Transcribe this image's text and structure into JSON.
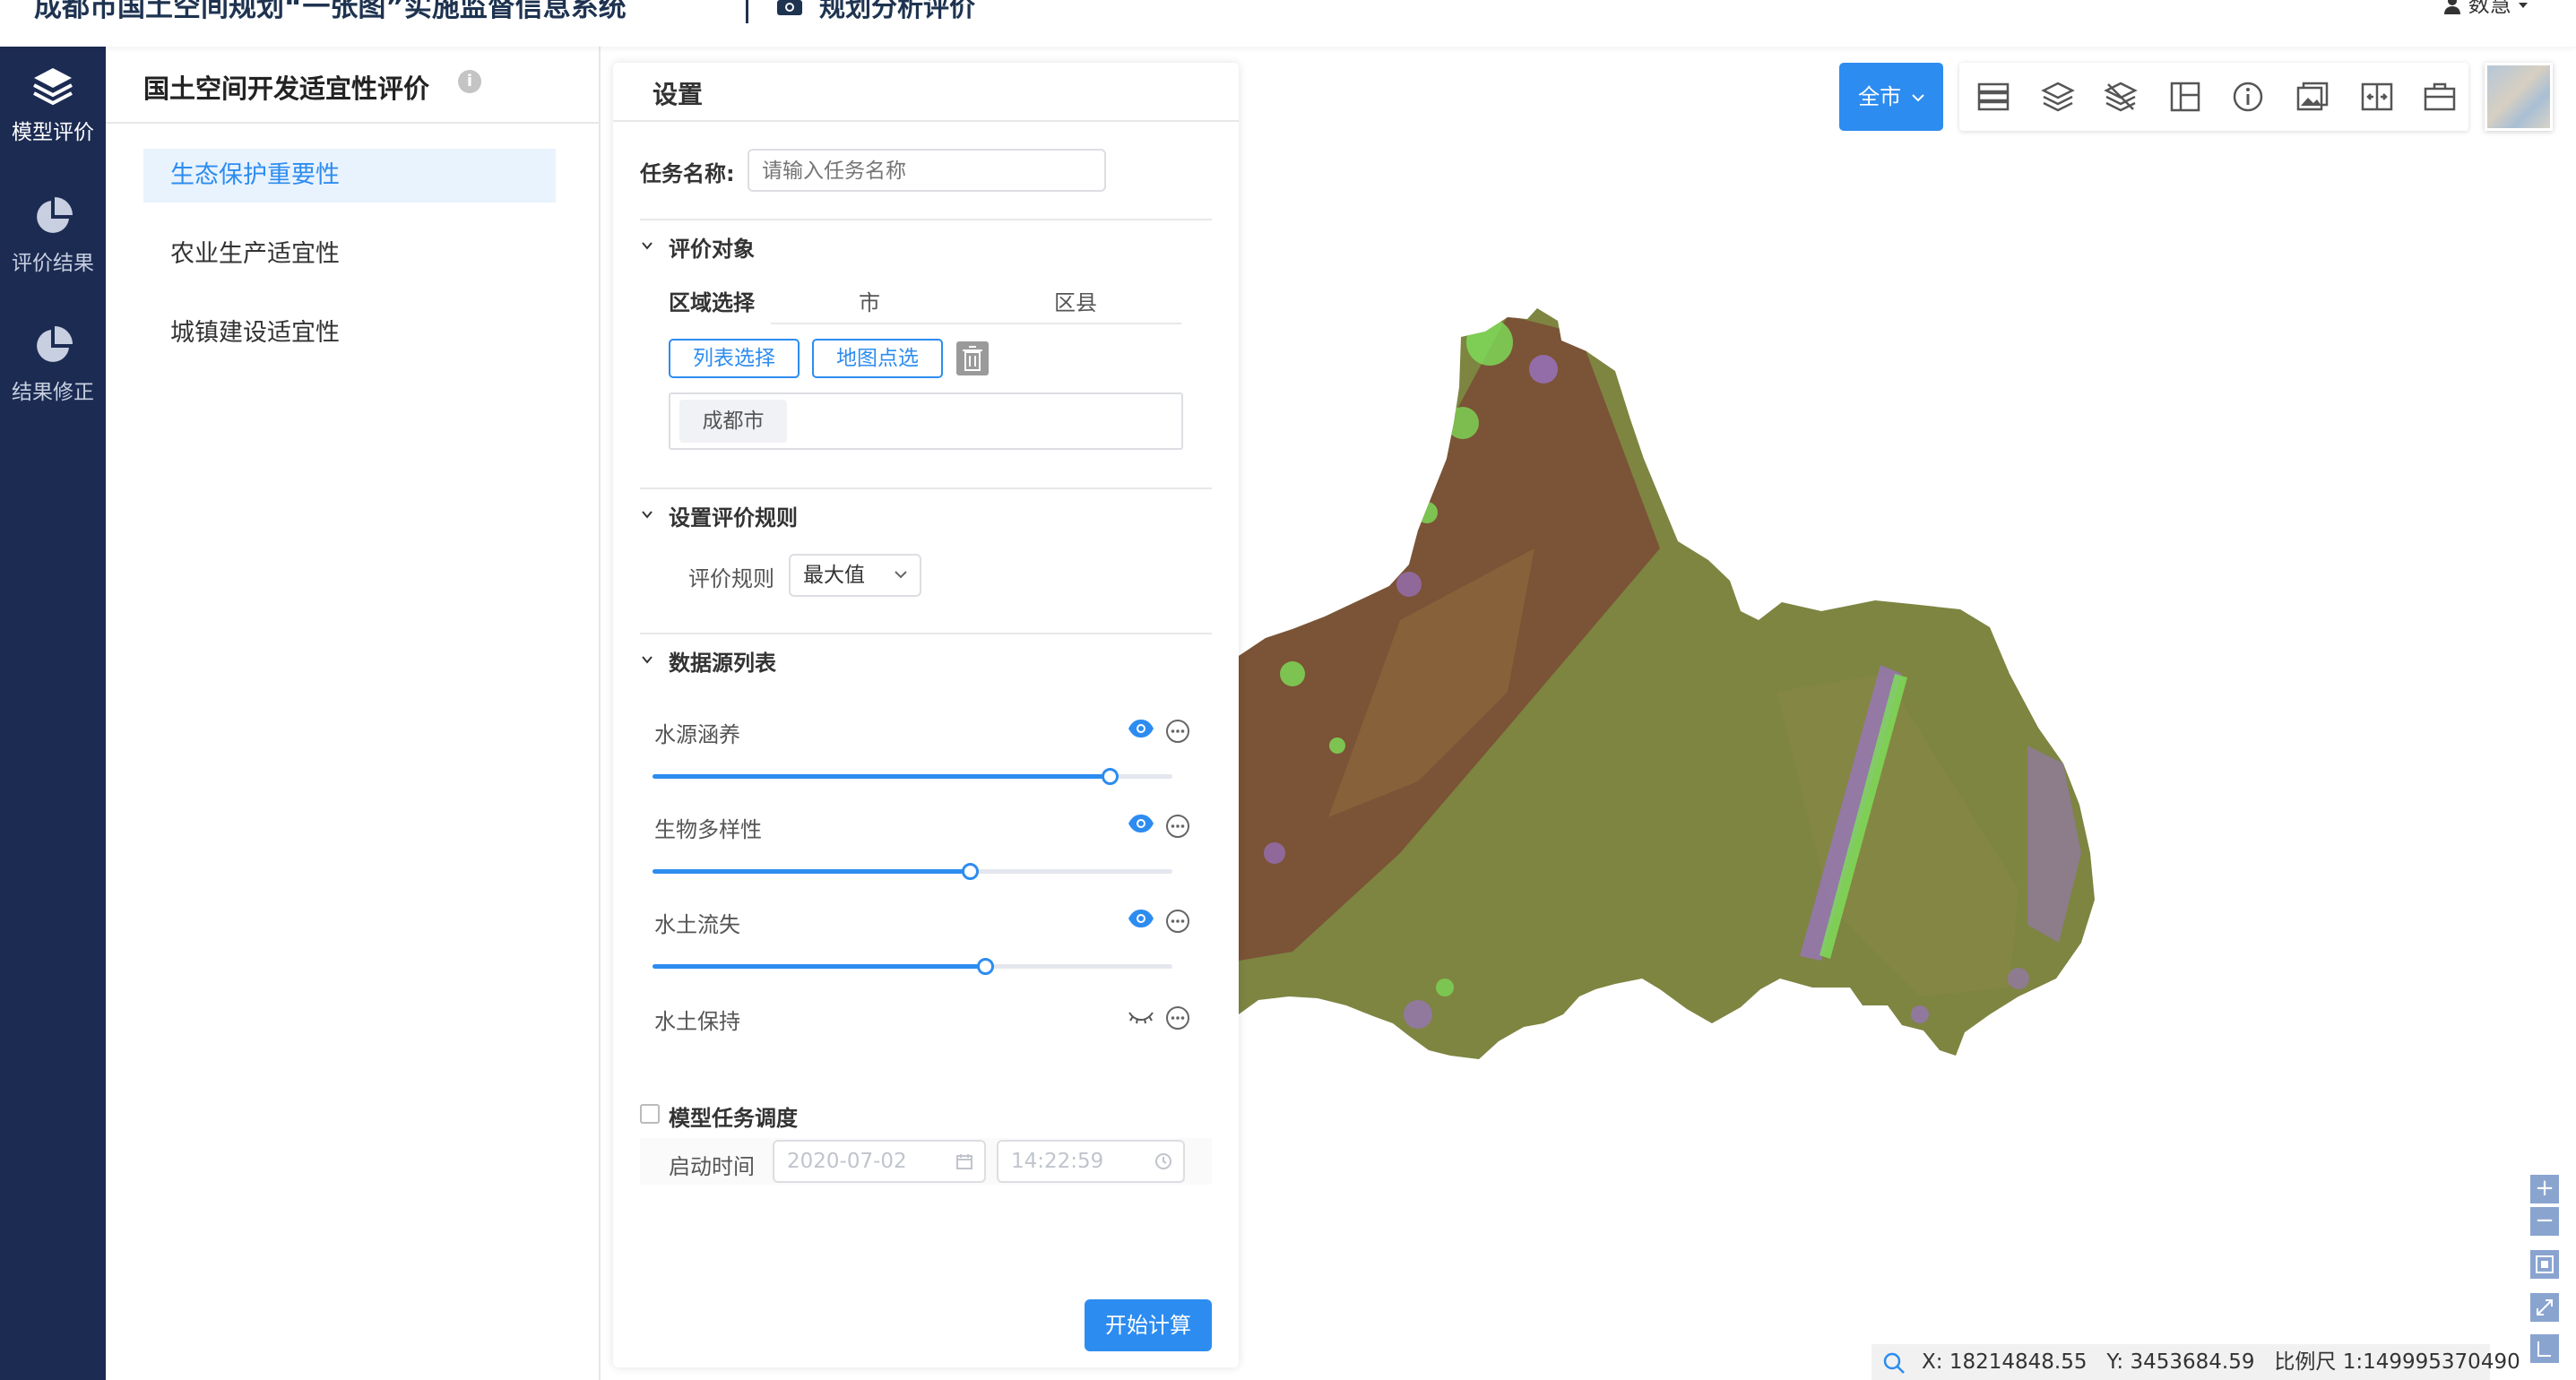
{
  "header": {
    "app_title": "成都市国土空间规划“一张图”实施监督信息系统",
    "module_title": "规划分析评价",
    "user_name": "数慧"
  },
  "nav": {
    "items": [
      {
        "label": "模型评价",
        "icon": "layers-icon",
        "active": true
      },
      {
        "label": "评价结果",
        "icon": "pie-chart-icon",
        "active": false
      },
      {
        "label": "结果修正",
        "icon": "pie-chart-icon",
        "active": false
      }
    ]
  },
  "submenu": {
    "title": "国土空间开发适宜性评价",
    "info_icon": "i",
    "items": [
      {
        "label": "生态保护重要性",
        "active": true
      },
      {
        "label": "农业生产适宜性",
        "active": false
      },
      {
        "label": "城镇建设适宜性",
        "active": false
      }
    ]
  },
  "settings": {
    "title": "设置",
    "task_name_label": "任务名称:",
    "task_name_placeholder": "请输入任务名称",
    "eval_object": {
      "section_title": "评价对象",
      "region_label": "区域选择",
      "region_tabs": [
        "市",
        "区县"
      ],
      "list_select_button": "列表选择",
      "map_select_button": "地图点选",
      "selected_tags": [
        "成都市"
      ]
    },
    "eval_rule": {
      "section_title": "设置评价规则",
      "rule_label": "评价规则",
      "rule_value": "最大值"
    },
    "datasource": {
      "section_title": "数据源列表",
      "items": [
        {
          "name": "水源涵养",
          "visible": true,
          "weight": 0.88
        },
        {
          "name": "生物多样性",
          "visible": true,
          "weight": 0.61
        },
        {
          "name": "水土流失",
          "visible": true,
          "weight": 0.64
        },
        {
          "name": "水土保持",
          "visible": false
        }
      ]
    },
    "schedule": {
      "checkbox_label": "模型任务调度",
      "checked": false,
      "start_time_label": "启动时间",
      "date_value": "2020-07-02",
      "time_value": "14:22:59"
    },
    "start_button": "开始计算"
  },
  "map": {
    "city_selector": "全市",
    "tools": [
      "list-icon",
      "layers-icon",
      "layers-clear-icon",
      "layout-icon",
      "info-icon",
      "album-icon",
      "split-compare-icon",
      "toolbox-icon"
    ],
    "controls": [
      "+",
      "−"
    ],
    "colors": {
      "base": "#7d8541",
      "upland": "#7a4a35",
      "green": "#7ee05a",
      "purple": "#9a74c4"
    },
    "status": {
      "x": "X: 18214848.55",
      "y": "Y: 3453684.59",
      "scale": "比例尺 1:149995370490"
    }
  }
}
